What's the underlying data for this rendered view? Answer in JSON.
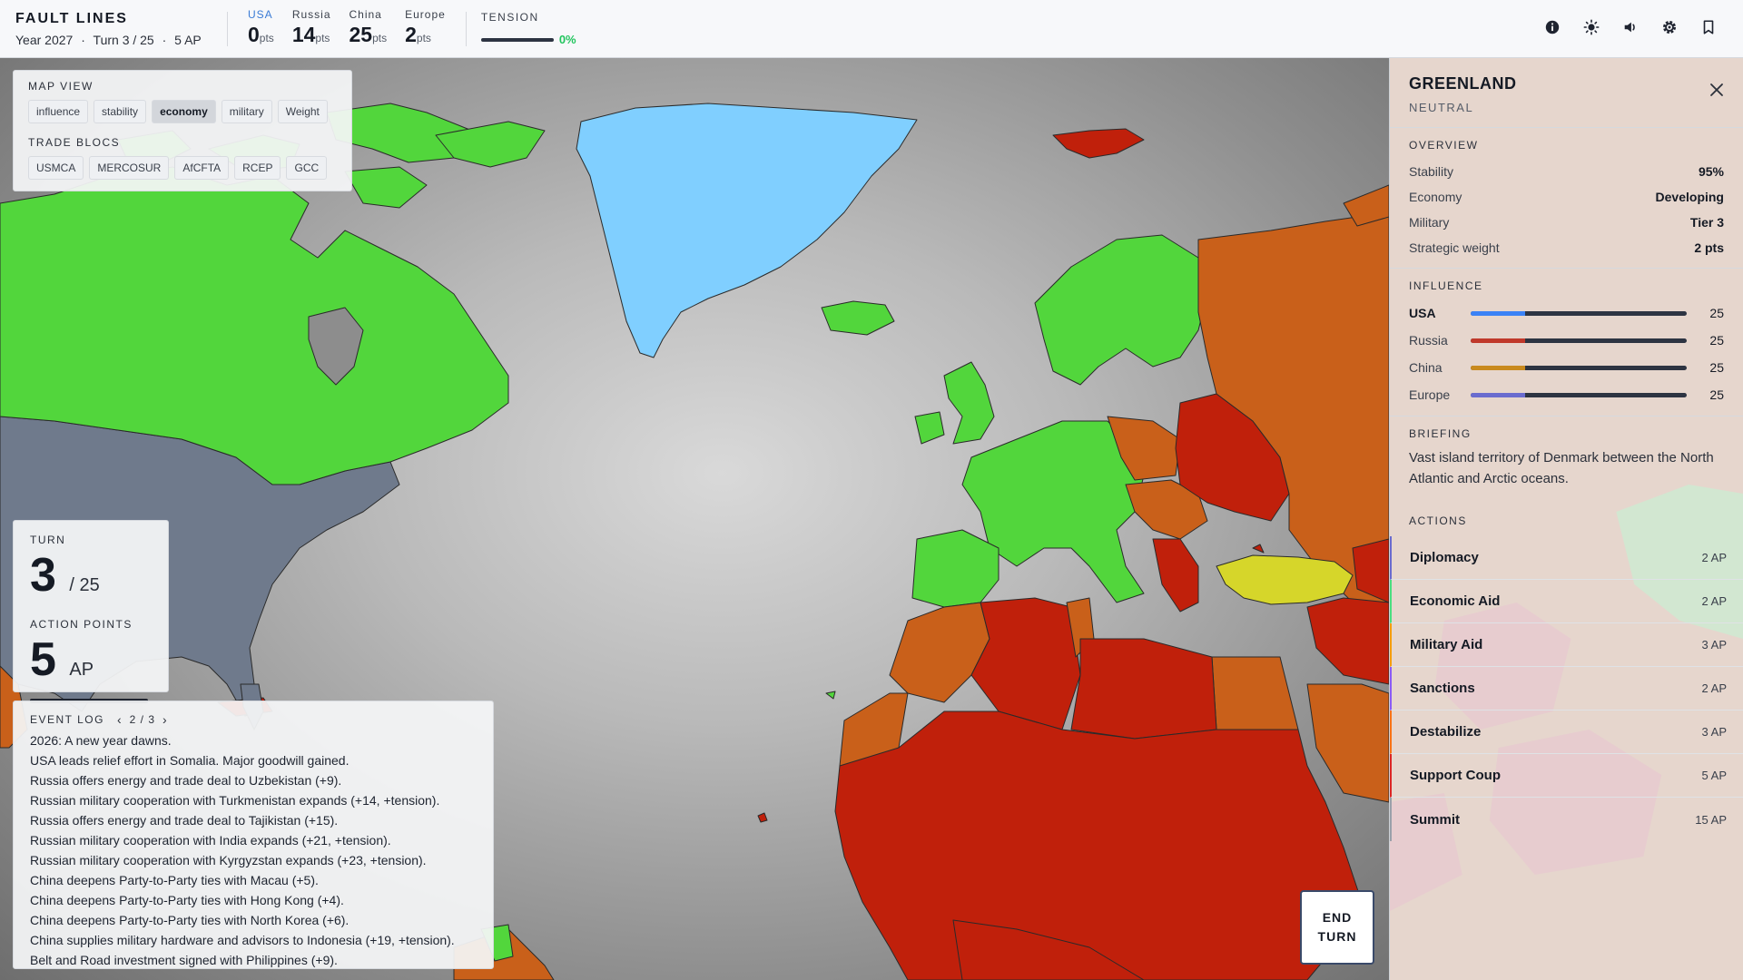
{
  "header": {
    "title": "FAULT LINES",
    "year": "Year 2027",
    "turn": "Turn 3 / 25",
    "ap": "5 AP",
    "separator": "·",
    "scores": [
      {
        "name": "USA",
        "value": "0",
        "unit": "pts",
        "active": true
      },
      {
        "name": "Russia",
        "value": "14",
        "unit": "pts",
        "active": false
      },
      {
        "name": "China",
        "value": "25",
        "unit": "pts",
        "active": false
      },
      {
        "name": "Europe",
        "value": "2",
        "unit": "pts",
        "active": false
      }
    ],
    "tension_label": "TENSION",
    "tension_value": "0%",
    "icons": [
      "info-icon",
      "sun-icon",
      "volume-icon",
      "gear-icon",
      "bookmark-icon"
    ]
  },
  "map_view": {
    "label": "MAP VIEW",
    "modes": [
      "influence",
      "stability",
      "economy",
      "military",
      "Weight"
    ],
    "selected": "economy",
    "trade_label": "TRADE BLOCS",
    "blocs": [
      "USMCA",
      "MERCOSUR",
      "AfCFTA",
      "RCEP",
      "GCC"
    ]
  },
  "turn_box": {
    "turn_label": "TURN",
    "turn": "3",
    "turn_total": "/ 25",
    "ap_label": "ACTION POINTS",
    "ap": "5",
    "ap_unit": "AP",
    "ap_fraction": 1.0
  },
  "event_log": {
    "label": "EVENT LOG",
    "page": "2 / 3",
    "prev": "‹",
    "next": "›",
    "lines": [
      "2026: A new year dawns.",
      "USA leads relief effort in Somalia. Major goodwill gained.",
      "Russia offers energy and trade deal to Uzbekistan (+9).",
      "Russian military cooperation with Turkmenistan expands (+14, +tension).",
      "Russia offers energy and trade deal to Tajikistan (+15).",
      "Russian military cooperation with India expands (+21, +tension).",
      "Russian military cooperation with Kyrgyzstan expands (+23, +tension).",
      "China deepens Party-to-Party ties with Macau (+5).",
      "China deepens Party-to-Party ties with Hong Kong (+4).",
      "China deepens Party-to-Party ties with North Korea (+6).",
      "China supplies military hardware and advisors to Indonesia (+19, +tension).",
      "Belt and Road investment signed with Philippines (+9)."
    ]
  },
  "end_turn": {
    "line1": "END",
    "line2": "TURN"
  },
  "side": {
    "title": "GREENLAND",
    "status": "NEUTRAL",
    "overview_label": "OVERVIEW",
    "overview": [
      {
        "k": "Stability",
        "v": "95%"
      },
      {
        "k": "Economy",
        "v": "Developing"
      },
      {
        "k": "Military",
        "v": "Tier 3"
      },
      {
        "k": "Strategic weight",
        "v": "2 pts"
      }
    ],
    "influence_label": "INFLUENCE",
    "influence": [
      {
        "name": "USA",
        "value": "25",
        "fraction": 0.25,
        "color": "#3b82f6"
      },
      {
        "name": "Russia",
        "value": "25",
        "fraction": 0.25,
        "color": "#c0392b"
      },
      {
        "name": "China",
        "value": "25",
        "fraction": 0.25,
        "color": "#c98a1e"
      },
      {
        "name": "Europe",
        "value": "25",
        "fraction": 0.25,
        "color": "#6a6ccf"
      }
    ],
    "briefing_label": "BRIEFING",
    "briefing": "Vast island territory of Denmark between the North Atlantic and Arctic oceans.",
    "actions_label": "ACTIONS",
    "actions": [
      {
        "name": "Diplomacy",
        "cost": "2 AP",
        "color": "#6a6ccf"
      },
      {
        "name": "Economic Aid",
        "cost": "2 AP",
        "color": "#4ade80"
      },
      {
        "name": "Military Aid",
        "cost": "3 AP",
        "color": "#f59e0b"
      },
      {
        "name": "Sanctions",
        "cost": "2 AP",
        "color": "#8b5cf6"
      },
      {
        "name": "Destabilize",
        "cost": "3 AP",
        "color": "#f97316"
      },
      {
        "name": "Support Coup",
        "cost": "5 AP",
        "color": "#dc2626"
      },
      {
        "name": "Summit",
        "cost": "15 AP",
        "color": "#9aa0aa"
      }
    ]
  },
  "colors": {
    "green": "#52d63c",
    "red": "#c0200b",
    "orange": "#c9601a",
    "yellow": "#d6d62a",
    "blue": "#80cfff",
    "slate": "#6f7a8c",
    "ocean": "#b9b9b9"
  }
}
